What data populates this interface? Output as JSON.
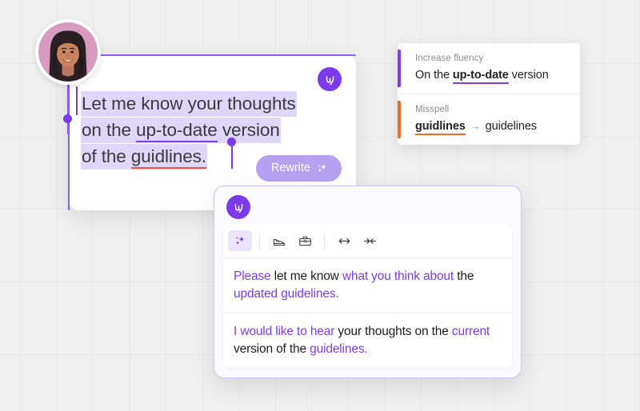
{
  "app": {
    "brand": "Writer",
    "logo_icon": "writer-logo-icon",
    "accent_purple": "#7c3aed",
    "accent_orange": "#f26b21",
    "highlight_color": "#ded7fb",
    "error_underline": "#f4543c"
  },
  "avatar": {
    "icon": "user-avatar-photo",
    "alt": "Smiling woman with long braided hair on a pink background"
  },
  "editor": {
    "badge_icon": "writer-logo-icon",
    "lines": [
      {
        "plain_before": "Let me know your thoughts",
        "underlined": "",
        "plain_after": ""
      },
      {
        "plain_before": "on the ",
        "underlined": "up-to-date",
        "underline_style": "purple",
        "plain_after": " version"
      },
      {
        "plain_before": "of the ",
        "underlined": "guidlines.",
        "underline_style": "red",
        "plain_after": ""
      }
    ],
    "full_text": "Let me know your thoughts on the up-to-date version of the guidlines.",
    "rewrite_button": {
      "label": "Rewrite",
      "icon": "sparkle-icon"
    }
  },
  "suggestions": [
    {
      "label": "Increase fluency",
      "accent": "#7c3aed",
      "accent_name": "fluency-accent-bar",
      "body_before": "On the ",
      "body_highlight": "up-to-date",
      "body_after": " version",
      "highlight_style": "purple"
    },
    {
      "label": "Misspell",
      "accent": "#f26b21",
      "accent_name": "misspell-accent-bar",
      "body_before": "",
      "body_highlight": "guidlines",
      "arrow": "→",
      "body_after": "guidelines",
      "highlight_style": "orange"
    }
  ],
  "rewrite_panel": {
    "badge_icon": "writer-logo-icon",
    "toolbar": [
      {
        "name": "tone-magic",
        "icon": "sparkle-icon",
        "label": "Magic rewrite",
        "active": true
      },
      {
        "name": "tone-casual",
        "icon": "sneaker-icon",
        "label": "Casual tone",
        "active": false
      },
      {
        "name": "tone-professional",
        "icon": "briefcase-icon",
        "label": "Professional tone",
        "active": false
      },
      {
        "name": "length-expand",
        "icon": "expand-arrows-icon",
        "label": "Expand",
        "active": false
      },
      {
        "name": "length-shorten",
        "icon": "shorten-arrows-icon",
        "label": "Shorten",
        "active": false
      }
    ],
    "variants": [
      {
        "segments": [
          {
            "text": "Please ",
            "highlight": true
          },
          {
            "text": "let me know ",
            "highlight": false
          },
          {
            "text": "what you think about ",
            "highlight": true
          },
          {
            "text": "the ",
            "highlight": false
          },
          {
            "text": "updated guidelines.",
            "highlight": true
          }
        ],
        "plain": "Please let me know what you think about the updated guidelines."
      },
      {
        "segments": [
          {
            "text": "I would like to hear ",
            "highlight": true
          },
          {
            "text": "your thoughts on the ",
            "highlight": false
          },
          {
            "text": "current ",
            "highlight": true
          },
          {
            "text": "version of the ",
            "highlight": false
          },
          {
            "text": "guidelines.",
            "highlight": true
          }
        ],
        "plain": "I would like to hear your thoughts on the current version of the guidelines."
      }
    ]
  }
}
